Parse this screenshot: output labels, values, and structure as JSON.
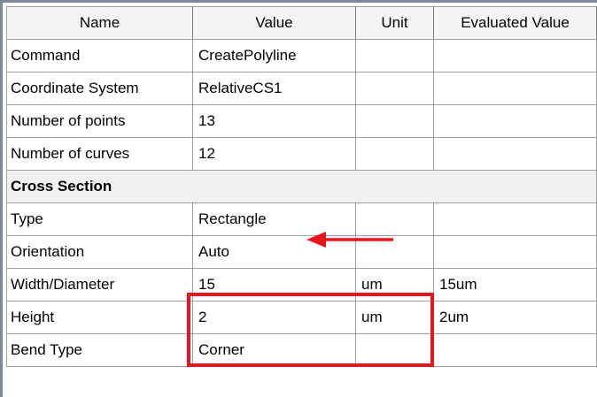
{
  "columns": {
    "name": "Name",
    "value": "Value",
    "unit": "Unit",
    "evaluated": "Evaluated Value"
  },
  "rows": [
    {
      "name": "Command",
      "value": "CreatePolyline",
      "unit": "",
      "evaluated": ""
    },
    {
      "name": "Coordinate System",
      "value": "RelativeCS1",
      "unit": "",
      "evaluated": ""
    },
    {
      "name": "Number of points",
      "value": "13",
      "unit": "",
      "evaluated": ""
    },
    {
      "name": "Number of curves",
      "value": "12",
      "unit": "",
      "evaluated": ""
    }
  ],
  "section": {
    "title": "Cross Section"
  },
  "section_rows": [
    {
      "name": "Type",
      "value": "Rectangle",
      "unit": "",
      "evaluated": ""
    },
    {
      "name": "Orientation",
      "value": "Auto",
      "unit": "",
      "evaluated": ""
    },
    {
      "name": "Width/Diameter",
      "value": "15",
      "unit": "um",
      "evaluated": "15um"
    },
    {
      "name": "Height",
      "value": "2",
      "unit": "um",
      "evaluated": "2um"
    },
    {
      "name": "Bend Type",
      "value": "Corner",
      "unit": "",
      "evaluated": ""
    }
  ],
  "annotation_color": "#e8141c"
}
